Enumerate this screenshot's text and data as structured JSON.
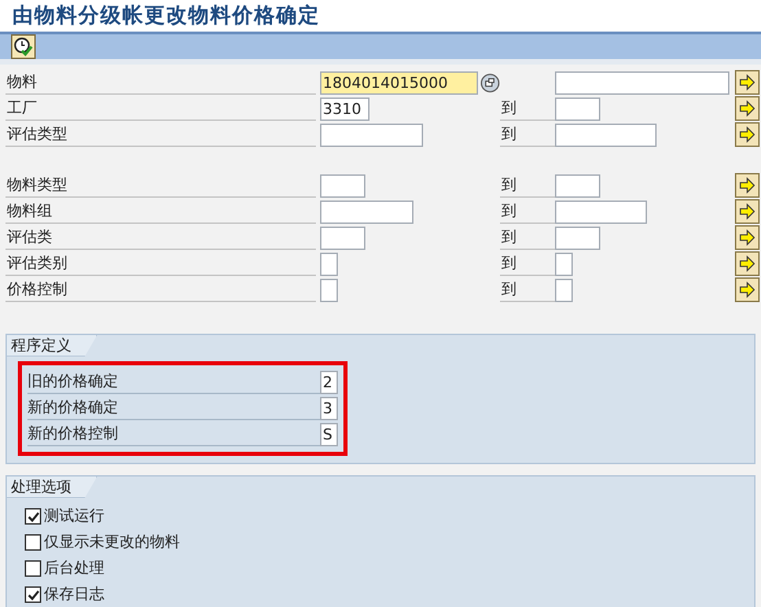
{
  "window": {
    "title": "由物料分级帐更改物料价格确定"
  },
  "toolbar": {
    "buttons": [
      {
        "kind": "execute"
      }
    ]
  },
  "selection": [
    {
      "label": "物料",
      "from": {
        "value": "1804014015000",
        "highlighted": true,
        "matchcode": true
      }
    },
    {
      "label": "工厂",
      "from": {
        "value": "3310",
        "highlighted": false,
        "matchcode": false
      },
      "to_label": "到"
    },
    {
      "label": "评估类型",
      "from": {
        "highlighted": false,
        "matchcode": false
      },
      "to_label": "到"
    },
    {
      "label": "物料类型",
      "from": {
        "highlighted": false,
        "matchcode": false
      },
      "to_label": "到"
    },
    {
      "label": "物料组",
      "from": {
        "highlighted": false,
        "matchcode": false
      },
      "to_label": "到"
    },
    {
      "label": "评估类",
      "from": {
        "highlighted": false,
        "matchcode": false
      },
      "to_label": "到"
    },
    {
      "label": "评估类别",
      "from": {
        "highlighted": false,
        "matchcode": false
      },
      "to_label": "到"
    },
    {
      "label": "价格控制",
      "from": {
        "highlighted": false,
        "matchcode": false
      },
      "to_label": "到"
    }
  ],
  "program_definition": {
    "title": "程序定义",
    "annotated": true,
    "fields": [
      {
        "label": "旧的价格确定",
        "value": "2"
      },
      {
        "label": "新的价格确定",
        "value": "3"
      },
      {
        "label": "新的价格控制",
        "value": "S"
      }
    ]
  },
  "processing_options": {
    "title": "处理选项",
    "options": [
      {
        "label": "测试运行",
        "checked": true
      },
      {
        "label": "仅显示未更改的物料",
        "checked": false
      },
      {
        "label": "后台处理",
        "checked": false
      },
      {
        "label": "保存日志",
        "checked": true
      }
    ]
  }
}
